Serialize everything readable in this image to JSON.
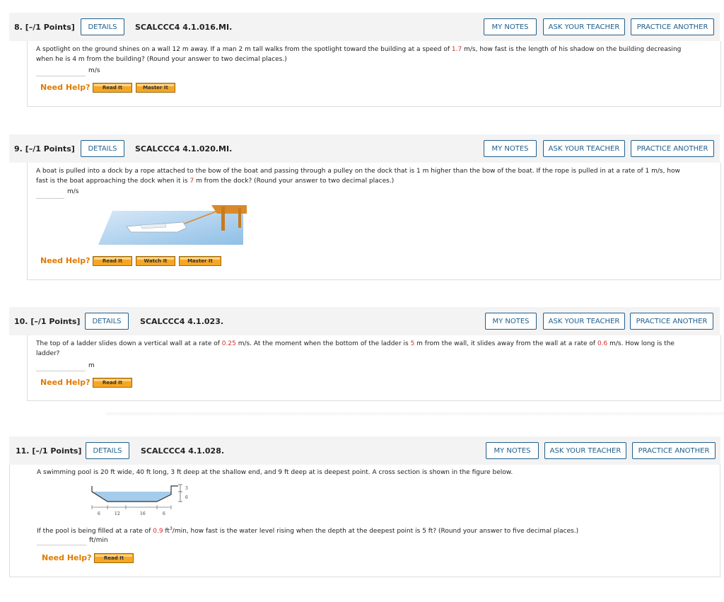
{
  "questions": [
    {
      "number": "8.",
      "points": "[–/1 Points]",
      "details": "DETAILS",
      "code": "SCALCCC4 4.1.016.MI.",
      "my_notes": "MY NOTES",
      "ask_teacher": "ASK YOUR TEACHER",
      "practice": "PRACTICE ANOTHER",
      "text_line1_a": "A spotlight on the ground shines on a wall 12 m away. If a man 2 m tall walks from the spotlight toward the building at a speed of ",
      "text_line1_red": "1.7",
      "text_line1_b": " m/s, how fast is the length of his shadow on the building decreasing",
      "text_line2": "when he is 4 m from the building? (Round your answer to two decimal places.)",
      "unit": "m/s",
      "need_help": "Need Help?",
      "help_buttons": [
        "Read It",
        "Master It"
      ]
    },
    {
      "number": "9.",
      "points": "[–/1 Points]",
      "details": "DETAILS",
      "code": "SCALCCC4 4.1.020.MI.",
      "my_notes": "MY NOTES",
      "ask_teacher": "ASK YOUR TEACHER",
      "practice": "PRACTICE ANOTHER",
      "text_line1": "A boat is pulled into a dock by a rope attached to the bow of the boat and passing through a pulley on the dock that is 1 m higher than the bow of the boat. If the rope is pulled in at a rate of 1 m/s, how",
      "text_line2_a": "fast is the boat approaching the dock when it is ",
      "text_line2_red": "7",
      "text_line2_b": " m from the dock? (Round your answer to two decimal places.)",
      "unit": "m/s",
      "need_help": "Need Help?",
      "help_buttons": [
        "Read It",
        "Watch It",
        "Master It"
      ]
    },
    {
      "number": "10.",
      "points": "[–/1 Points]",
      "details": "DETAILS",
      "code": "SCALCCC4 4.1.023.",
      "my_notes": "MY NOTES",
      "ask_teacher": "ASK YOUR TEACHER",
      "practice": "PRACTICE ANOTHER",
      "text_line1_a": "The top of a ladder slides down a vertical wall at a rate of ",
      "text_line1_red1": "0.25",
      "text_line1_b": " m/s. At the moment when the bottom of the ladder is ",
      "text_line1_red2": "5",
      "text_line1_c": " m from the wall, it slides away from the wall at a rate of ",
      "text_line1_red3": "0.6",
      "text_line1_d": " m/s. How long is the",
      "text_line2": "ladder?",
      "unit": "m",
      "need_help": "Need Help?",
      "help_buttons": [
        "Read It"
      ]
    },
    {
      "number": "11.",
      "points": "[–/1 Points]",
      "details": "DETAILS",
      "code": "SCALCCC4 4.1.028.",
      "my_notes": "MY NOTES",
      "ask_teacher": "ASK YOUR TEACHER",
      "practice": "PRACTICE ANOTHER",
      "text_line1": "A swimming pool is 20 ft wide, 40 ft long, 3 ft deep at the shallow end, and 9 ft deep at is deepest point. A cross section is shown in the figure below.",
      "figure_labels": [
        "6",
        "12",
        "16",
        "6",
        "3",
        "6"
      ],
      "text_line2_a": "If the pool is being filled at a rate of ",
      "text_line2_red": "0.9",
      "text_line2_b": " ft",
      "text_line2_sup": "3",
      "text_line2_c": "/min, how fast is the water level rising when the depth at the deepest point is 5 ft? (Round your answer to five decimal places.)",
      "unit": "ft/min",
      "need_help": "Need Help?",
      "help_buttons": [
        "Read It"
      ]
    }
  ]
}
